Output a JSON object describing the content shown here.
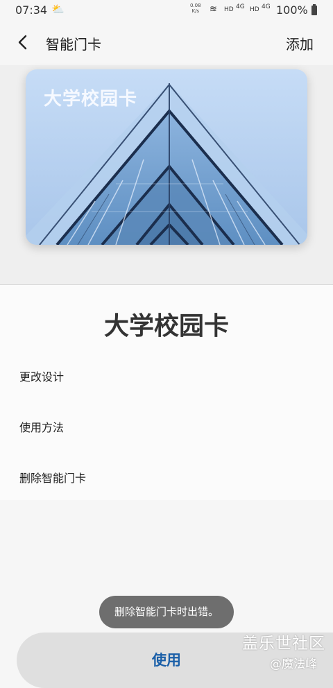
{
  "status_bar": {
    "time": "07:34",
    "weather_icon": "cloud-sun-icon",
    "net_speed_value": "0.08",
    "net_speed_unit": "K/s",
    "hd1": "HD",
    "g1": "4G",
    "hd2": "HD",
    "g2": "4G",
    "battery": "100%"
  },
  "appbar": {
    "title": "智能门卡",
    "add_label": "添加"
  },
  "card": {
    "title": "大学校园卡",
    "colors": {
      "sky": "#b9d3f2",
      "glass": "#6f9bc8",
      "frame": "#1b2e4d"
    }
  },
  "details": {
    "card_name": "大学校园卡",
    "menu": [
      {
        "label": "更改设计"
      },
      {
        "label": "使用方法"
      },
      {
        "label": "删除智能门卡"
      }
    ]
  },
  "toast": {
    "text": "删除智能门卡时出错。"
  },
  "bottom": {
    "use_label": "使用"
  },
  "watermark": {
    "line1": "盖乐世社区",
    "line2": "@魔法峰"
  }
}
